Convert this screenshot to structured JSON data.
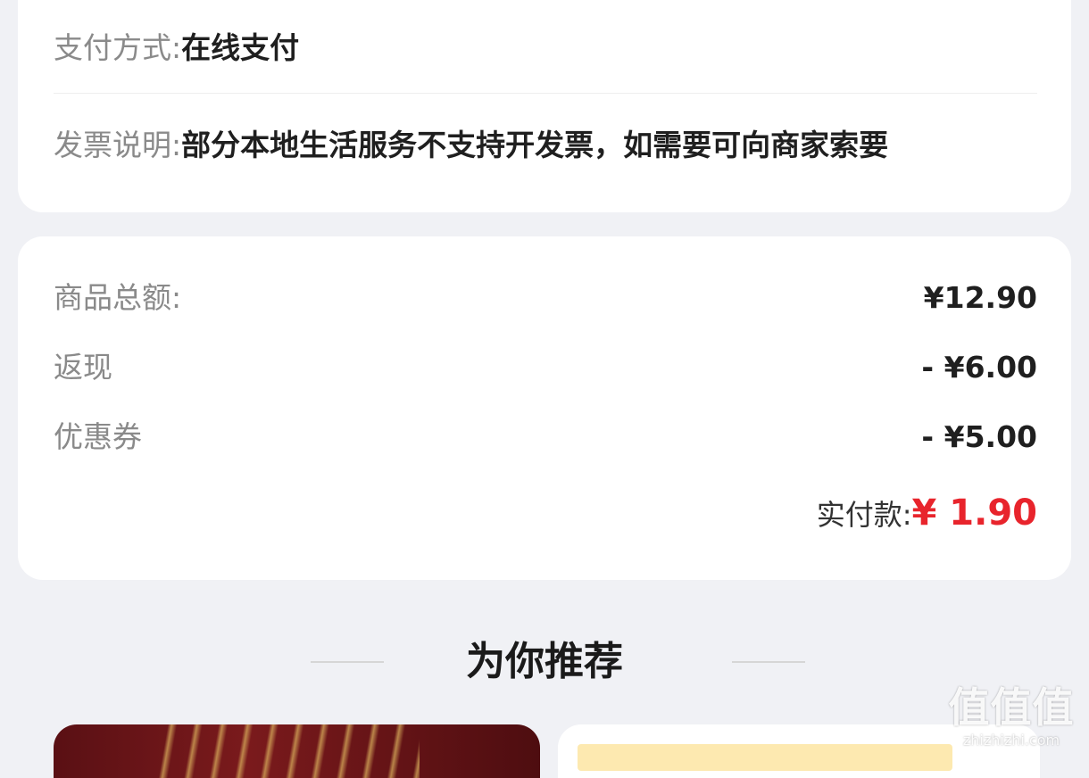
{
  "order_info": {
    "payment_label": "支付方式:",
    "payment_value": "在线支付",
    "invoice_label": "发票说明:",
    "invoice_value": "部分本地生活服务不支持开发票，如需要可向商家索要"
  },
  "amounts": {
    "subtotal_label": "商品总额:",
    "subtotal_value": "¥12.90",
    "cashback_label": "返现",
    "cashback_value": "- ¥6.00",
    "coupon_label": "优惠券",
    "coupon_value": "- ¥5.00",
    "paid_label": "实付款:",
    "paid_value": "¥ 1.90",
    "accent_color": "#e8242c"
  },
  "recommend": {
    "title": "为你推荐"
  },
  "watermark": {
    "brand": "值值值",
    "domain": "zhizhizhi.com"
  }
}
